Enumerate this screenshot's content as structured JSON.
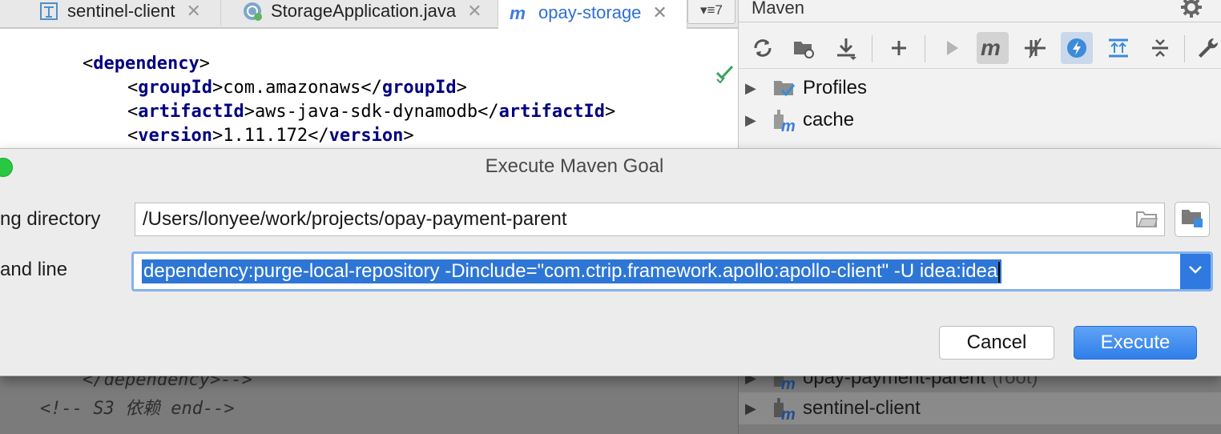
{
  "tabs": [
    {
      "label": "sentinel-client",
      "icon": "module-icon"
    },
    {
      "label": "StorageApplication.java",
      "icon": "spring-boot-class-icon"
    },
    {
      "label": "opay-storage",
      "icon": "maven-m-icon"
    }
  ],
  "tab_overflow": {
    "count": "7"
  },
  "editor": {
    "lines": [
      {
        "indent": "",
        "open": "dependency"
      },
      {
        "indent": "    ",
        "open": "groupId",
        "text": "com.amazonaws",
        "close": "groupId"
      },
      {
        "indent": "    ",
        "open": "artifactId",
        "text": "aws-java-sdk-dynamodb",
        "close": "artifactId"
      },
      {
        "indent": "    ",
        "open": "version",
        "text": "1.11.172",
        "close": "version"
      },
      {
        "indent": "",
        "close_only": "dependency"
      }
    ]
  },
  "bottom_editor": {
    "line1": "    </dependency>-->",
    "line2": "<!-- S3 依赖 end-->"
  },
  "maven": {
    "title": "Maven",
    "tree_top": [
      {
        "label": "Profiles",
        "icon": "profiles-icon"
      },
      {
        "label": "cache",
        "icon": "maven-module-icon"
      }
    ],
    "tree_bottom": [
      {
        "label": "opay-payment-parent",
        "suffix": "(root)",
        "icon": "maven-module-icon"
      },
      {
        "label": "sentinel-client",
        "icon": "maven-module-icon"
      }
    ]
  },
  "dialog": {
    "title": "Execute Maven Goal",
    "working_directory_label": "ng directory",
    "working_directory_value": "/Users/lonyee/work/projects/opay-payment-parent",
    "command_line_label": "and line",
    "command_line_value": "dependency:purge-local-repository -Dinclude=\"com.ctrip.framework.apollo:apollo-client\" -U idea:idea",
    "cancel_label": "Cancel",
    "execute_label": "Execute"
  },
  "colors": {
    "accent": "#2f7eea",
    "xml_tag": "#000080",
    "selection": "#2e76d6"
  }
}
